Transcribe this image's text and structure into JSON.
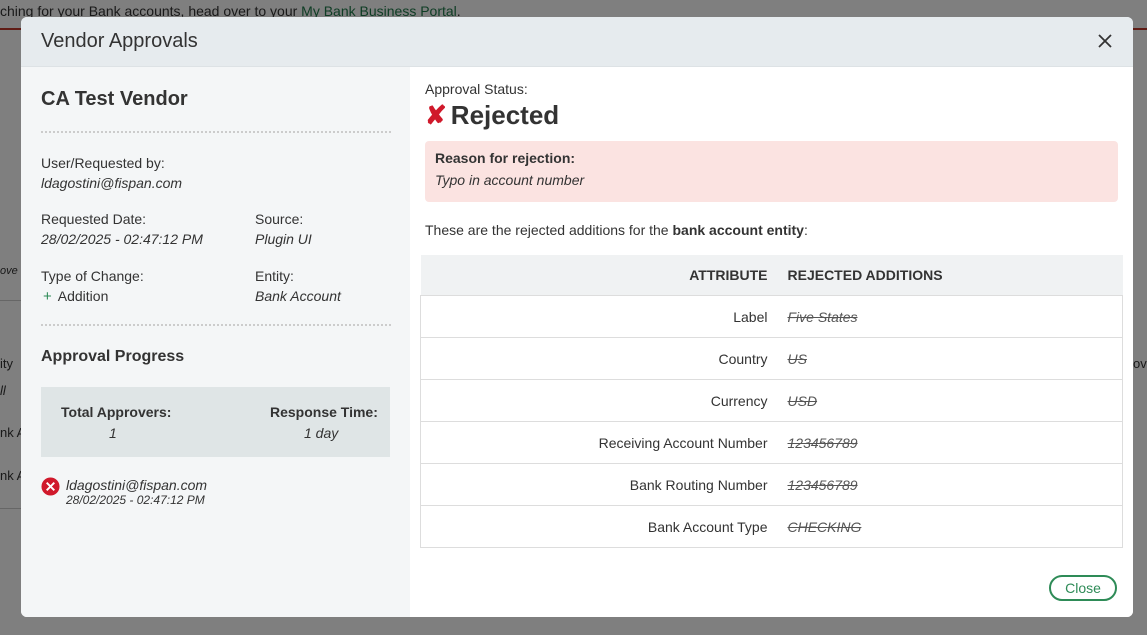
{
  "background": {
    "banner_text": "ching for your Bank accounts, head over to your ",
    "banner_link": "My Bank Business Portal",
    "banner_suffix": ".",
    "side_fragments": [
      "ove",
      "ity",
      "ll",
      "nk A",
      "nk A"
    ],
    "right_fragments": [
      "ove"
    ]
  },
  "modal": {
    "title": "Vendor Approvals",
    "close_icon": "close-icon"
  },
  "vendor": {
    "name": "CA Test Vendor",
    "user_label": "User/Requested by:",
    "user_value": "ldagostini@fispan.com",
    "date_label": "Requested Date:",
    "date_value": "28/02/2025 - 02:47:12 PM",
    "source_label": "Source:",
    "source_value": "Plugin UI",
    "change_label": "Type of Change:",
    "change_value": "Addition",
    "entity_label": "Entity:",
    "entity_value": "Bank Account"
  },
  "progress": {
    "title": "Approval Progress",
    "total_label": "Total Approvers:",
    "total_value": "1",
    "response_label": "Response Time:",
    "response_value": "1 day",
    "approver_email": "ldagostini@fispan.com",
    "approver_date": "28/02/2025 - 02:47:12 PM"
  },
  "status": {
    "label": "Approval Status:",
    "value": "Rejected",
    "reason_label": "Reason for rejection:",
    "reason_value": "Typo in account number",
    "intro_text": "These are the rejected additions for the ",
    "intro_entity": "bank account entity",
    "intro_suffix": ":"
  },
  "table": {
    "headers": [
      "Attribute",
      "Rejected Additions"
    ],
    "rows": [
      {
        "attribute": "Label",
        "value": "Five States"
      },
      {
        "attribute": "Country",
        "value": "US"
      },
      {
        "attribute": "Currency",
        "value": "USD"
      },
      {
        "attribute": "Receiving Account Number",
        "value": "123456789"
      },
      {
        "attribute": "Bank Routing Number",
        "value": "123456789"
      },
      {
        "attribute": "Bank Account Type",
        "value": "CHECKING"
      }
    ]
  },
  "footer": {
    "close_label": "Close"
  },
  "colors": {
    "accent_green": "#2e8b57",
    "reject_red": "#d0192b",
    "reason_bg": "#fbe3e1"
  }
}
